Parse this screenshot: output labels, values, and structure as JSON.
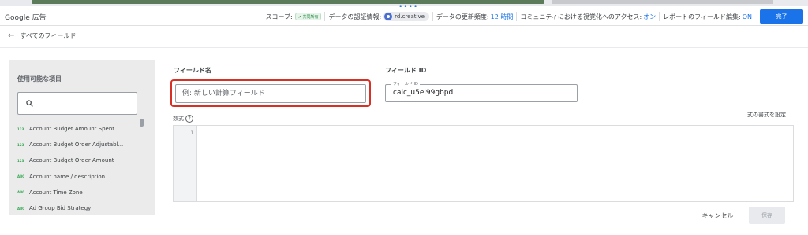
{
  "header": {
    "app_title": "Google 広告",
    "scope_label": "スコープ:",
    "scope_chip": "↗ 共同所有",
    "credentials_label": "データの認証情報:",
    "credentials_user": "rd.creative",
    "freshness_label": "データの更新頻度:",
    "freshness_value": "12 時間",
    "community_label": "コミュニティにおける視覚化へのアクセス:",
    "community_value": "オン",
    "report_edit_label": "レポートのフィールド編集:",
    "report_edit_value": "ON",
    "done_button": "完了"
  },
  "nav": {
    "back_label": "すべてのフィールド"
  },
  "left_panel": {
    "title": "使用可能な項目",
    "search_placeholder": "",
    "fields": [
      {
        "type": "123",
        "label": "Account Budget Amount Spent"
      },
      {
        "type": "123",
        "label": "Account Budget Order Adjustabl..."
      },
      {
        "type": "123",
        "label": "Account Budget Order Amount"
      },
      {
        "type": "ABC",
        "label": "Account name / description"
      },
      {
        "type": "ABC",
        "label": "Account Time Zone"
      },
      {
        "type": "ABC",
        "label": "Ad Group Bid Strategy"
      }
    ]
  },
  "form": {
    "field_name_label": "フィールド名",
    "field_name_placeholder": "例: 新しい計算フィールド",
    "field_id_label": "フィールド ID",
    "field_id_legend": "フィールド ID",
    "field_id_value": "calc_u5el99gbpd",
    "formula_label": "数式",
    "help_icon": "?",
    "format_link": "式の書式を設定",
    "line_number": "1"
  },
  "actions": {
    "cancel": "キャンセル",
    "save": "保存"
  },
  "colors": {
    "accent": "#1a73e8",
    "highlight_border": "#d93025",
    "panel_bg": "#ebebeb"
  }
}
